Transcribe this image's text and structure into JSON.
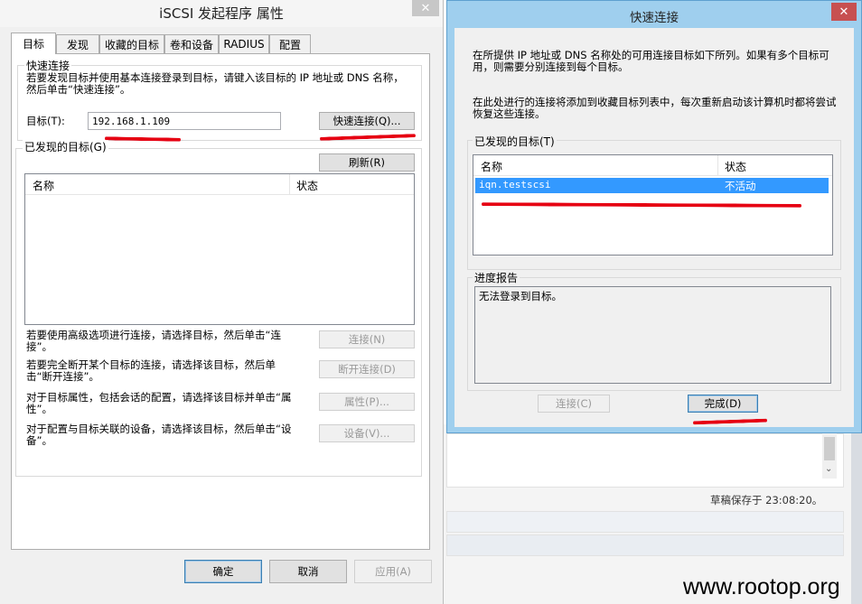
{
  "left_dialog": {
    "title": "iSCSI 发起程序 属性",
    "tabs": [
      "目标",
      "发现",
      "收藏的目标",
      "卷和设备",
      "RADIUS",
      "配置"
    ],
    "quick_connect": {
      "group_label": "快速连接",
      "description": "若要发现目标并使用基本连接登录到目标，请键入该目标的 IP 地址或 DNS 名称，然后单击“快速连接”。",
      "target_label": "目标(T):",
      "target_value": "192.168.1.109",
      "button": "快速连接(Q)..."
    },
    "discovered": {
      "group_label": "已发现的目标(G)",
      "refresh_button": "刷新(R)",
      "columns": [
        "名称",
        "状态"
      ]
    },
    "actions": [
      {
        "text": "若要使用高级选项进行连接，请选择目标，然后单击“连接”。",
        "button": "连接(N)"
      },
      {
        "text": "若要完全断开某个目标的连接，请选择该目标，然后单击“断开连接”。",
        "button": "断开连接(D)"
      },
      {
        "text": "对于目标属性，包括会话的配置，请选择该目标并单击“属性”。",
        "button": "属性(P)..."
      },
      {
        "text": "对于配置与目标关联的设备，请选择该目标，然后单击“设备”。",
        "button": "设备(V)..."
      }
    ],
    "footer": {
      "ok": "确定",
      "cancel": "取消",
      "apply": "应用(A)"
    }
  },
  "right_dialog": {
    "title": "快速连接",
    "para1": "在所提供 IP 地址或 DNS 名称处的可用连接目标如下所列。如果有多个目标可用，则需要分别连接到每个目标。",
    "para2": "在此处进行的连接将添加到收藏目标列表中，每次重新启动该计算机时都将尝试恢复这些连接。",
    "discovered_label": "已发现的目标(T)",
    "columns": [
      "名称",
      "状态"
    ],
    "rows": [
      {
        "name": "iqn.testscsi",
        "status": "不活动"
      }
    ],
    "progress_label": "进度报告",
    "progress_text": "无法登录到目标。",
    "connect_button": "连接(C)",
    "done_button": "完成(D)"
  },
  "background": {
    "draft_saved": "草稿保存于 23:08:20。",
    "watermark": "www.rootop.org"
  },
  "colors": {
    "selection": "#3399ff",
    "annotation": "#e60012",
    "title_bar": "#9fcfee"
  }
}
